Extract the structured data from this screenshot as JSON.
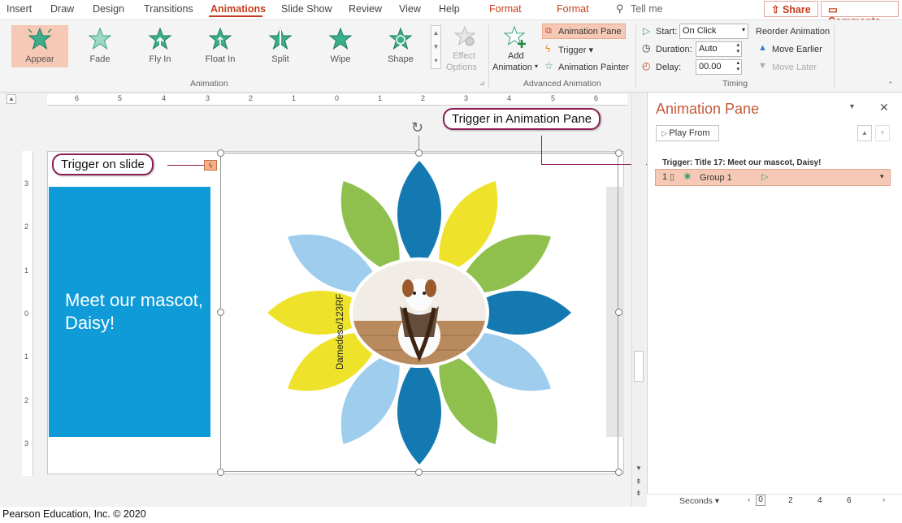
{
  "tabs": [
    "Insert",
    "Draw",
    "Design",
    "Transitions",
    "Animations",
    "Slide Show",
    "Review",
    "View",
    "Help",
    "Format",
    "Format"
  ],
  "tell_me": "Tell me",
  "share_label": "Share",
  "comments_label": "Comments",
  "animation_gallery": [
    "Appear",
    "Fade",
    "Fly In",
    "Float In",
    "Split",
    "Wipe",
    "Shape"
  ],
  "effect_options": [
    "Effect",
    "Options"
  ],
  "group_labels": {
    "animation": "Animation",
    "advanced": "Advanced Animation",
    "timing": "Timing"
  },
  "advanced": {
    "add_animation": [
      "Add",
      "Animation"
    ],
    "animation_pane": "Animation Pane",
    "trigger": "Trigger",
    "animation_painter": "Animation Painter"
  },
  "timing": {
    "start_label": "Start:",
    "start_value": "On Click",
    "duration_label": "Duration:",
    "duration_value": "Auto",
    "delay_label": "Delay:",
    "delay_value": "00.00",
    "reorder": "Reorder Animation",
    "move_earlier": "Move Earlier",
    "move_later": "Move Later"
  },
  "ruler_h": [
    "6",
    "5",
    "4",
    "3",
    "2",
    "1",
    "0",
    "1",
    "2",
    "3",
    "4",
    "5",
    "6"
  ],
  "ruler_v": [
    "3",
    "2",
    "1",
    "0",
    "1",
    "2",
    "3"
  ],
  "slide": {
    "title_text": "Meet our mascot, Daisy!",
    "photo_credit": "Damedeso/123RF"
  },
  "callouts": {
    "on_slide": "Trigger on slide",
    "in_pane": "Trigger in Animation Pane"
  },
  "pane": {
    "title": "Animation Pane",
    "play_from": "Play From",
    "trigger_header": "Trigger: Title 17: Meet our mascot, Daisy!",
    "row_number": "1",
    "row_label": "Group 1"
  },
  "status": {
    "seconds": "Seconds",
    "ticks": [
      "0",
      "2",
      "4",
      "6"
    ]
  },
  "copyright": "Pearson Education, Inc. © 2020",
  "colors": {
    "accent": "#c43e1c",
    "slide_blue": "#0f9bd7",
    "petal_dark_blue": "#1479b0",
    "petal_light_blue": "#9fcdee",
    "petal_yellow": "#eee32a",
    "petal_green": "#8fc04e",
    "callout_border": "#8d1d55"
  }
}
